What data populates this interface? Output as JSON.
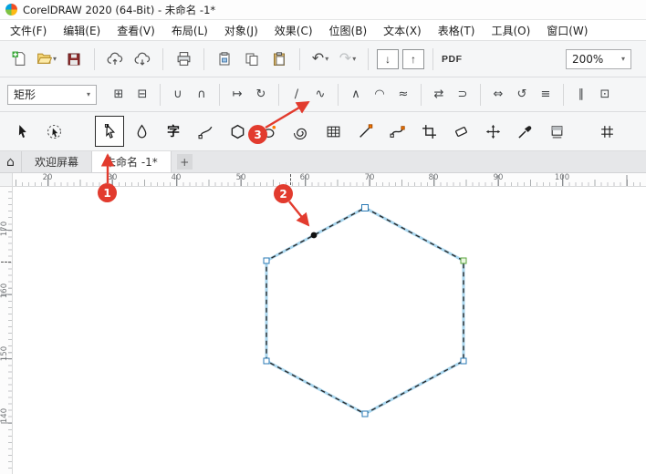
{
  "window": {
    "title": "CorelDRAW 2020 (64-Bit) - 未命名 -1*"
  },
  "menu": {
    "items": [
      "文件(F)",
      "编辑(E)",
      "查看(V)",
      "布局(L)",
      "对象(J)",
      "效果(C)",
      "位图(B)",
      "文本(X)",
      "表格(T)",
      "工具(O)",
      "窗口(W)"
    ]
  },
  "icons": {
    "caret": "▾",
    "home": "⌂",
    "import": "↓",
    "export": "↑",
    "undo": "↶",
    "redo": "↷",
    "new_tab": "+",
    "text_tool": "字"
  },
  "stdbar": {
    "zoom": "200%",
    "pdf": "PDF"
  },
  "propbar": {
    "preset": "矩形",
    "buttons": [
      {
        "name": "add-node",
        "glyph": "⊞"
      },
      {
        "name": "delete-node",
        "glyph": "⊟"
      },
      {
        "name": "join-nodes",
        "glyph": "∪"
      },
      {
        "name": "break-node",
        "glyph": "∩"
      },
      {
        "name": "extend-curve",
        "glyph": "↦"
      },
      {
        "name": "auto-close-curve",
        "glyph": "↻"
      },
      {
        "name": "convert-to-line",
        "glyph": "∕"
      },
      {
        "name": "convert-to-curve",
        "glyph": "∿"
      },
      {
        "name": "cusp-node",
        "glyph": "∧"
      },
      {
        "name": "smooth-node",
        "glyph": "◠"
      },
      {
        "name": "symmetrical-node",
        "glyph": "≈"
      },
      {
        "name": "reverse-direction",
        "glyph": "⇄"
      },
      {
        "name": "close-curve",
        "glyph": "⊃"
      },
      {
        "name": "stretch-nodes",
        "glyph": "⇔"
      },
      {
        "name": "rotate-nodes",
        "glyph": "↺"
      },
      {
        "name": "align-nodes",
        "glyph": "≡"
      },
      {
        "name": "elastic-mode",
        "glyph": "∥"
      },
      {
        "name": "select-all-nodes",
        "glyph": "⊡"
      }
    ]
  },
  "tabbar": {
    "tabs": [
      "欢迎屏幕",
      "未命名 -1*"
    ]
  },
  "rulers": {
    "h": [
      "20",
      "30",
      "40",
      "50",
      "60",
      "70",
      "80",
      "90",
      "100"
    ],
    "v": [
      "170",
      "160",
      "150",
      "140"
    ]
  },
  "steps": [
    "1",
    "2",
    "3"
  ],
  "colors": {
    "annotation_red": "#e23b2e",
    "selection_blue": "#a9d6ee",
    "node_stroke": "#2a7ab5",
    "accent_orange": "#ff7a00"
  },
  "canvas_shape": {
    "type": "hexagon",
    "mode": "node-editing",
    "nodes": 6,
    "added_node_on_edge": true
  }
}
